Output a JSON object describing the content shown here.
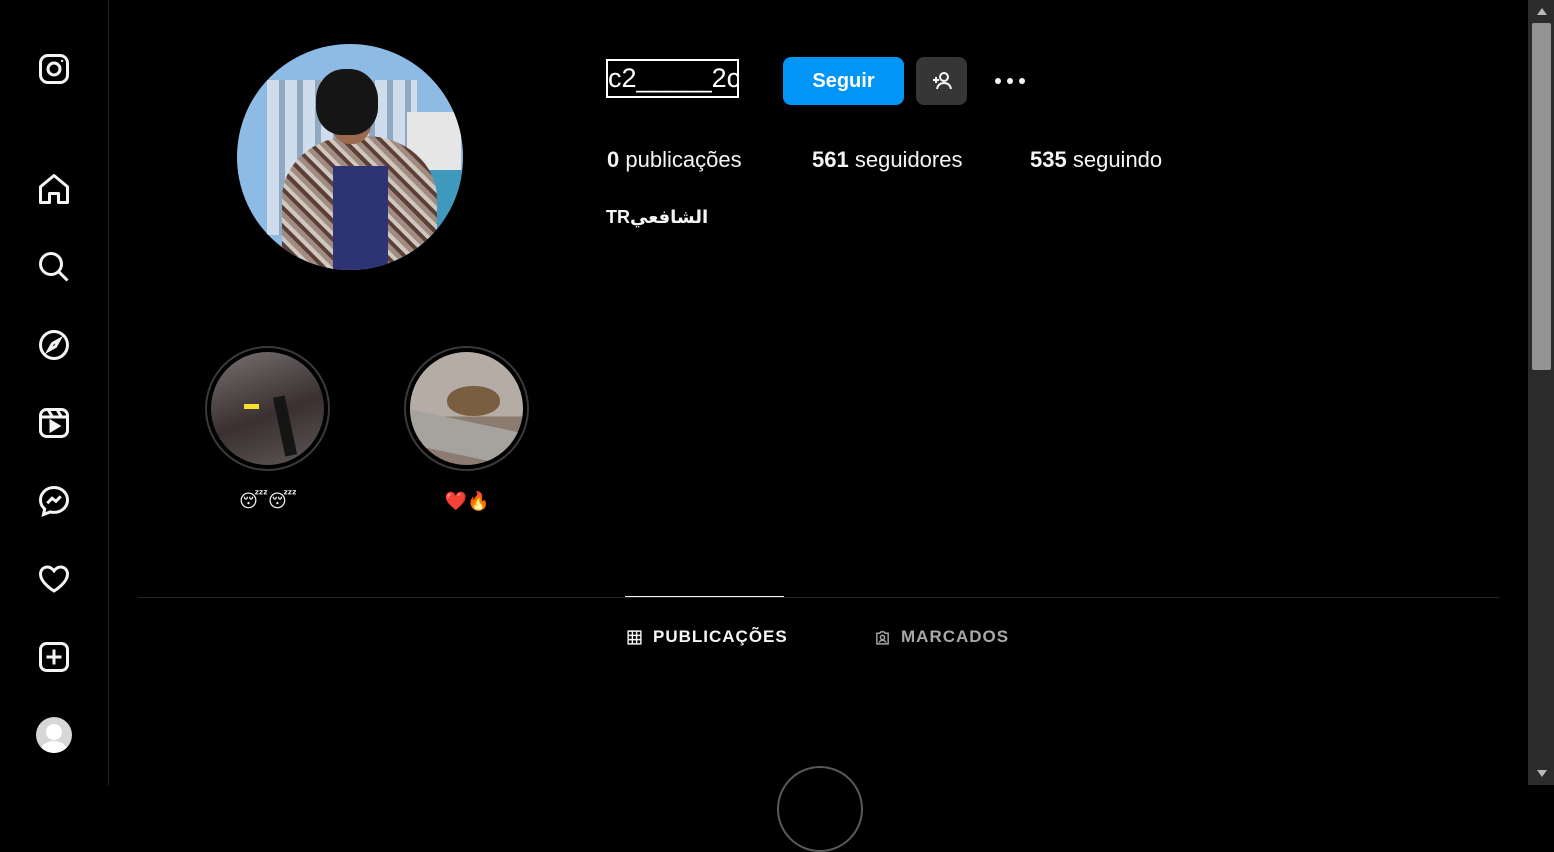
{
  "sidebar": {
    "items": [
      {
        "name": "instagram-logo-icon"
      },
      {
        "name": "home-icon"
      },
      {
        "name": "search-icon"
      },
      {
        "name": "explore-icon"
      },
      {
        "name": "reels-icon"
      },
      {
        "name": "messenger-icon"
      },
      {
        "name": "heart-icon"
      },
      {
        "name": "create-icon"
      },
      {
        "name": "profile-avatar"
      }
    ]
  },
  "profile": {
    "username": "c2_____2c",
    "follow_label": "Seguir",
    "stats": [
      {
        "count": "0",
        "label": "publicações"
      },
      {
        "count": "561",
        "label": "seguidores"
      },
      {
        "count": "535",
        "label": "seguindo"
      }
    ],
    "bio": "TRالشافعي"
  },
  "highlights": [
    {
      "label": "😴😴"
    },
    {
      "label": "❤️🔥"
    }
  ],
  "tabs": {
    "posts": "PUBLICAÇÕES",
    "tagged": "MARCADOS"
  },
  "colors": {
    "background": "#000000",
    "accent": "#0095f6",
    "secondary_button": "#363636",
    "divider": "#262626"
  }
}
